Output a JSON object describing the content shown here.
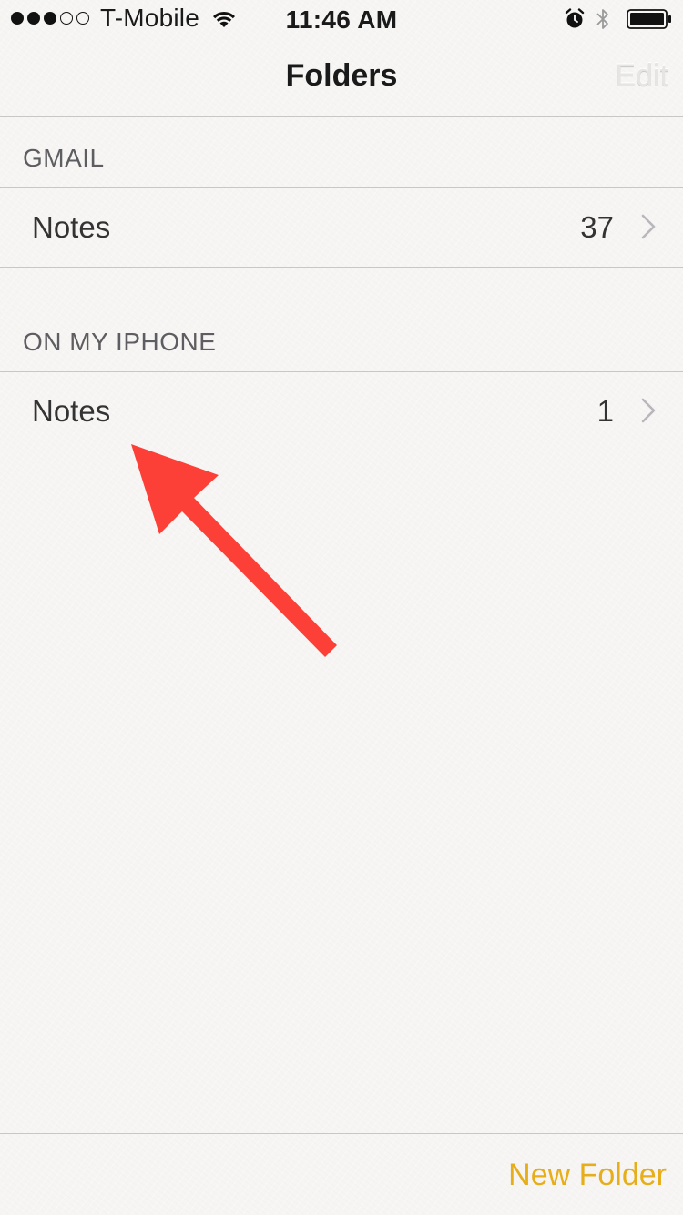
{
  "status_bar": {
    "signal_full": 3,
    "signal_total": 5,
    "carrier": "T-Mobile",
    "time": "11:46 AM",
    "icons": [
      "wifi-icon",
      "alarm-icon",
      "bluetooth-icon",
      "battery-icon"
    ],
    "battery_level": 1.0
  },
  "nav": {
    "title": "Folders",
    "edit_label": "Edit"
  },
  "sections": [
    {
      "header": "GMAIL",
      "rows": [
        {
          "label": "Notes",
          "count": "37"
        }
      ]
    },
    {
      "header": "ON MY IPHONE",
      "rows": [
        {
          "label": "Notes",
          "count": "1"
        }
      ]
    }
  ],
  "toolbar": {
    "new_folder_label": "New Folder"
  },
  "colors": {
    "accent": "#e6ae1a",
    "annotation_arrow": "#fd4037",
    "background": "#f6f5f3",
    "separator": "#c8c7c5"
  },
  "icons": {
    "row_chevron": "chevron-right-icon"
  }
}
